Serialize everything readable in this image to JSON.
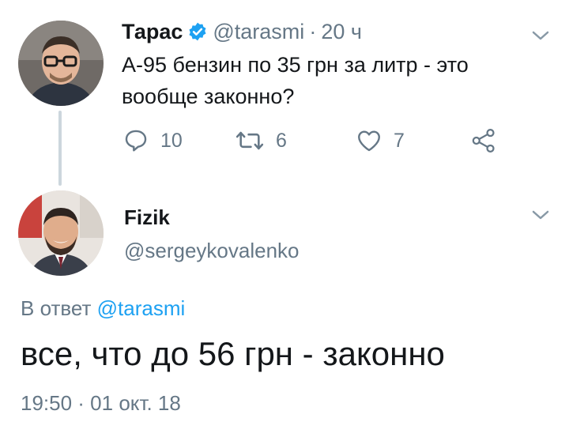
{
  "tweet": {
    "author_name": "Тарас",
    "author_handle": "@tarasmi",
    "separator": "·",
    "time": "20 ч",
    "text": "А-95 бензин по 35 грн за литр - это вообще законно?",
    "actions": {
      "replies": "10",
      "retweets": "6",
      "likes": "7"
    }
  },
  "reply": {
    "author_name": "Fizik",
    "author_handle": "@sergeykovalenko",
    "reply_to_prefix": "В ответ",
    "reply_to_handle": "@tarasmi",
    "text": "все, что до 56 грн - законно",
    "timestamp": "19:50 · 01 окт. 18"
  },
  "colors": {
    "accent": "#1da1f2",
    "secondary_text": "#657786",
    "primary_text": "#14171a",
    "thread_line": "#ccd6dd"
  }
}
